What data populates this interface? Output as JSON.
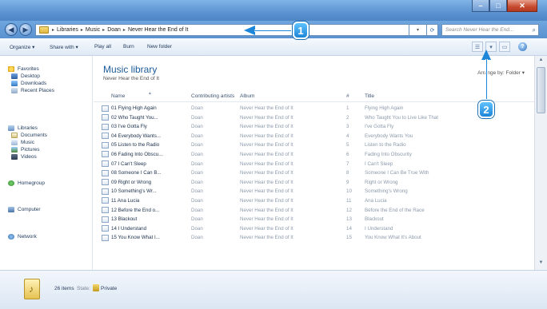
{
  "address": {
    "crumbs": [
      "Libraries",
      "Music",
      "Doan",
      "Never Hear the End of It"
    ],
    "dropdown_glyph": "▾",
    "search_placeholder": "Search Never Hear the End..."
  },
  "toolbar": {
    "organize": "Organize ▾",
    "share_with": "Share with ▾",
    "play_all": "Play all",
    "burn": "Burn",
    "new_folder": "New folder"
  },
  "nav": {
    "favorites": "Favorites",
    "desktop": "Desktop",
    "downloads": "Downloads",
    "recent": "Recent Places",
    "libraries": "Libraries",
    "documents": "Documents",
    "music": "Music",
    "pictures": "Pictures",
    "videos": "Videos",
    "homegroup": "Homegroup",
    "computer": "Computer",
    "network": "Network"
  },
  "library": {
    "title": "Music library",
    "subtitle": "Never Hear the End of It",
    "arrange_by": "Arrange by: Folder ▾"
  },
  "columns": {
    "name": "Name",
    "artists": "Contributing artists",
    "album": "Album",
    "number": "#",
    "title": "Title"
  },
  "rows": [
    {
      "name": "01 Flying High Again",
      "artist": "Doan",
      "album": "Never Hear the End of It",
      "num": "1",
      "title": "Flying High Again"
    },
    {
      "name": "02 Who Taught You...",
      "artist": "Doan",
      "album": "Never Hear the End of It",
      "num": "2",
      "title": "Who Taught You to Live Like That"
    },
    {
      "name": "03 I've Gotta Fly",
      "artist": "Doan",
      "album": "Never Hear the End of It",
      "num": "3",
      "title": "I've Gotta Fly"
    },
    {
      "name": "04 Everybody Wants...",
      "artist": "Doan",
      "album": "Never Hear the End of It",
      "num": "4",
      "title": "Everybody Wants You"
    },
    {
      "name": "05 Listen to the Radio",
      "artist": "Doan",
      "album": "Never Hear the End of It",
      "num": "5",
      "title": "Listen to the Radio"
    },
    {
      "name": "06 Fading Into Obscu...",
      "artist": "Doan",
      "album": "Never Hear the End of It",
      "num": "6",
      "title": "Fading Into Obscurity"
    },
    {
      "name": "07 I Can't Sleep",
      "artist": "Doan",
      "album": "Never Hear the End of It",
      "num": "7",
      "title": "I Can't Sleep"
    },
    {
      "name": "08 Someone I Can B...",
      "artist": "Doan",
      "album": "Never Hear the End of It",
      "num": "8",
      "title": "Someone I Can Be True With"
    },
    {
      "name": "09 Right or Wrong",
      "artist": "Doan",
      "album": "Never Hear the End of It",
      "num": "9",
      "title": "Right or Wrong"
    },
    {
      "name": "10 Something's Wr...",
      "artist": "Doan",
      "album": "Never Hear the End of It",
      "num": "10",
      "title": "Something's Wrong"
    },
    {
      "name": "11 Ana Lucia",
      "artist": "Doan",
      "album": "Never Hear the End of It",
      "num": "11",
      "title": "Ana Lucia"
    },
    {
      "name": "12 Before the End o...",
      "artist": "Doan",
      "album": "Never Hear the End of It",
      "num": "12",
      "title": "Before the End of the Race"
    },
    {
      "name": "13 Blackout",
      "artist": "Doan",
      "album": "Never Hear the End of It",
      "num": "13",
      "title": "Blackout"
    },
    {
      "name": "14 I Understand",
      "artist": "Doan",
      "album": "Never Hear the End of It",
      "num": "14",
      "title": "I Understand"
    },
    {
      "name": "15 You Know What I...",
      "artist": "Doan",
      "album": "Never Hear the End of It",
      "num": "15",
      "title": "You Know What It's About"
    }
  ],
  "details": {
    "items": "26 items",
    "state": "State:",
    "sharing": "Private"
  },
  "callouts": {
    "one": "1",
    "two": "2"
  },
  "window": {
    "minimize": "–",
    "maximize": "□",
    "close": "✕"
  }
}
